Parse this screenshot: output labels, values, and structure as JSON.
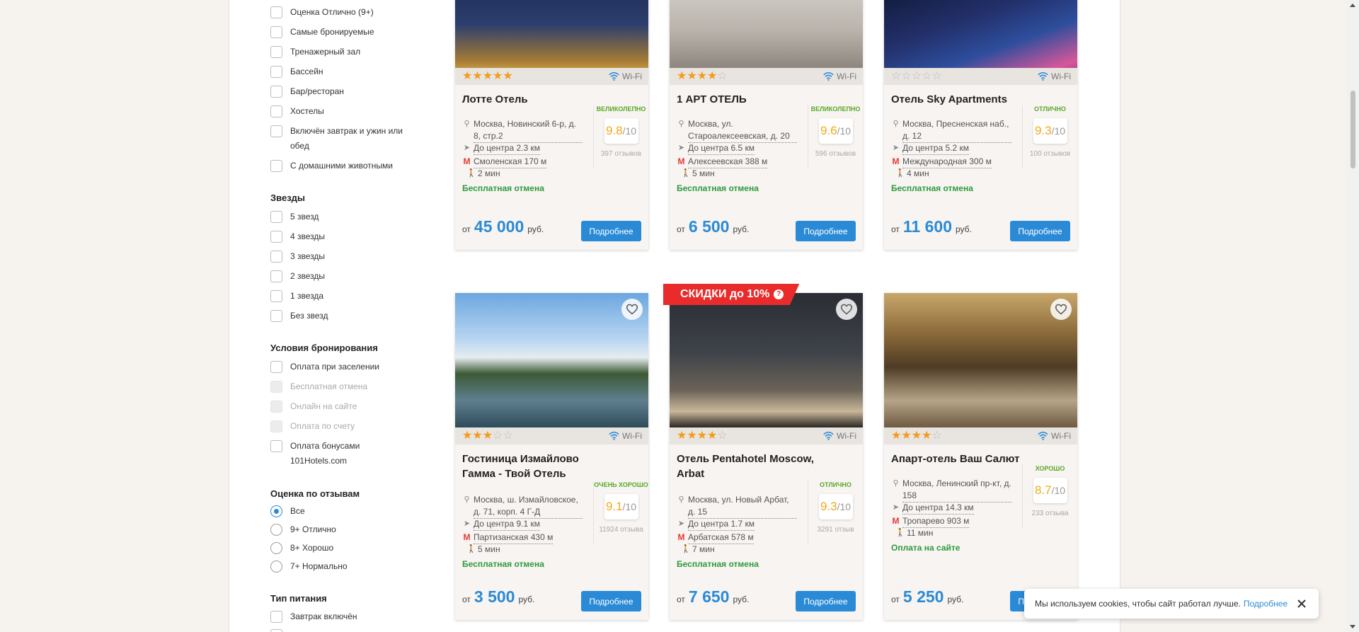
{
  "sidebar": {
    "amenities": [
      "Оценка Отлично (9+)",
      "Самые бронируемые",
      "Тренажерный зал",
      "Бассейн",
      "Бар/ресторан",
      "Хостелы",
      "Включён завтрак и ужин или обед",
      "С домашними животными"
    ],
    "stars_title": "Звезды",
    "stars": [
      "5 звезд",
      "4 звезды",
      "3 звезды",
      "2 звезды",
      "1 звезда",
      "Без звезд"
    ],
    "booking_title": "Условия бронирования",
    "booking": [
      {
        "label": "Оплата при заселении",
        "disabled": false
      },
      {
        "label": "Бесплатная отмена",
        "disabled": true
      },
      {
        "label": "Онлайн на сайте",
        "disabled": true
      },
      {
        "label": "Оплата по счету",
        "disabled": true
      },
      {
        "label": "Оплата бонусами 101Hotels.com",
        "disabled": false
      }
    ],
    "reviews_title": "Оценка по отзывам",
    "reviews": [
      {
        "label": "Все",
        "selected": true
      },
      {
        "label": "9+ Отлично",
        "selected": false
      },
      {
        "label": "8+ Хорошо",
        "selected": false
      },
      {
        "label": "7+ Нормально",
        "selected": false
      }
    ],
    "food_title": "Тип питания",
    "food": [
      "Завтрак включён"
    ]
  },
  "common": {
    "wifi": "Wi-Fi",
    "price_from": "от",
    "currency": "руб.",
    "more_button": "Подробнее",
    "score_denominator": "/10"
  },
  "hotels": [
    {
      "name": "Лотте Отель",
      "stars": 5,
      "address": "Москва, Новинский 6-р, д. 8, стр.2",
      "distance": "До центра 2.3 км",
      "metro": "Смоленская 170 м",
      "walk": "2 мин",
      "perk": "Бесплатная отмена",
      "score_cat": "великолепно",
      "score": "9.8",
      "reviews": "397 отзывов",
      "price": "45 000"
    },
    {
      "name": "1 АРТ ОТЕЛЬ",
      "stars": 4,
      "address": "Москва, ул. Староалексеевская, д. 20",
      "distance": "До центра 6.5 км",
      "metro": "Алексеевская 388 м",
      "walk": "5 мин",
      "perk": "Бесплатная отмена",
      "score_cat": "великолепно",
      "score": "9.6",
      "reviews": "596 отзывов",
      "price": "6 500"
    },
    {
      "name": "Отель Sky Apartments",
      "stars": 0,
      "address": "Москва, Пресненская наб., д. 12",
      "distance": "До центра 5.2 км",
      "metro": "Международная 300 м",
      "walk": "4 мин",
      "perk": "Бесплатная отмена",
      "score_cat": "отлично",
      "score": "9.3",
      "reviews": "100 отзывов",
      "price": "11 600"
    },
    {
      "name": "Гостиница Измайлово Гамма - Твой Отель",
      "stars": 3,
      "address": "Москва, ш. Измайловское, д. 71, корп. 4 Г-Д",
      "distance": "До центра 9.1 км",
      "metro": "Партизанская 430 м",
      "walk": "5 мин",
      "perk": "Бесплатная отмена",
      "score_cat": "очень хорошо",
      "score": "9.1",
      "reviews": "11924 отзыва",
      "price": "3 500"
    },
    {
      "name": "Отель Pentahotel Moscow, Arbat",
      "stars": 4,
      "address": "Москва, ул. Новый Арбат, д. 15",
      "distance": "До центра 1.7 км",
      "metro": "Арбатская 578 м",
      "walk": "7 мин",
      "perk": "Бесплатная отмена",
      "score_cat": "отлично",
      "score": "9.3",
      "reviews": "3291 отзыв",
      "price": "7 650",
      "promo": "СКИДКИ до 10%"
    },
    {
      "name": "Апарт-отель Ваш Салют",
      "stars": 4,
      "address": "Москва, Ленинский пр-кт, д. 158",
      "distance": "До центра 14.3 км",
      "metro": "Тропарево 903 м",
      "walk": "11 мин",
      "perk": "Оплата на сайте",
      "score_cat": "хорошо",
      "score": "8.7",
      "reviews": "233 отзыва",
      "price": "5 250"
    }
  ],
  "cookie": {
    "text": "Мы используем cookies, чтобы сайт работал лучше.",
    "link": "Подробнее"
  },
  "colors": {
    "accent": "#2b8ad6",
    "star": "#f59b1b",
    "free": "#2e9a3d",
    "score": "#f0a81a",
    "promo": "#ea2b2b"
  }
}
